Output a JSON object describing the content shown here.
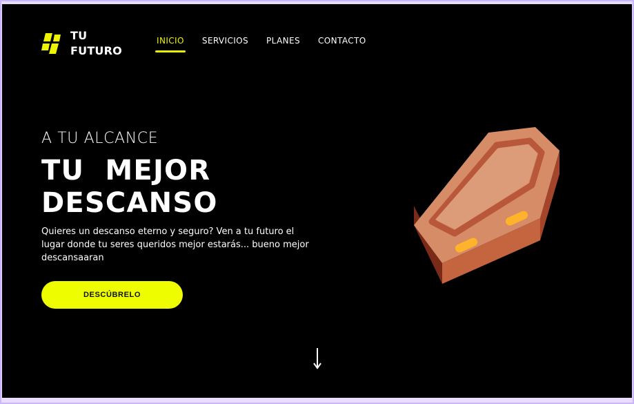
{
  "brand": {
    "line1": "TU",
    "line2": "FUTURO",
    "icon": "logo-blocks-icon",
    "accent_color": "#eef400"
  },
  "nav": {
    "items": [
      {
        "label": "INICIO",
        "active": true
      },
      {
        "label": "SERVICIOS",
        "active": false
      },
      {
        "label": "PLANES",
        "active": false
      },
      {
        "label": "CONTACTO",
        "active": false
      }
    ]
  },
  "hero": {
    "eyebrow": "A TU ALCANCE",
    "headline_line1": "TU  MEJOR",
    "headline_line2": "DESCANSO",
    "description": "Quieres un descanso eterno y seguro? Ven a tu futuro el lugar donde tu seres queridos mejor estarás... bueno mejor descansaaran",
    "cta_label": "DESCÚBRELO",
    "cta_color": "#eefe00",
    "illustration": "coffin-illustration",
    "scroll_icon": "arrow-down-icon"
  }
}
